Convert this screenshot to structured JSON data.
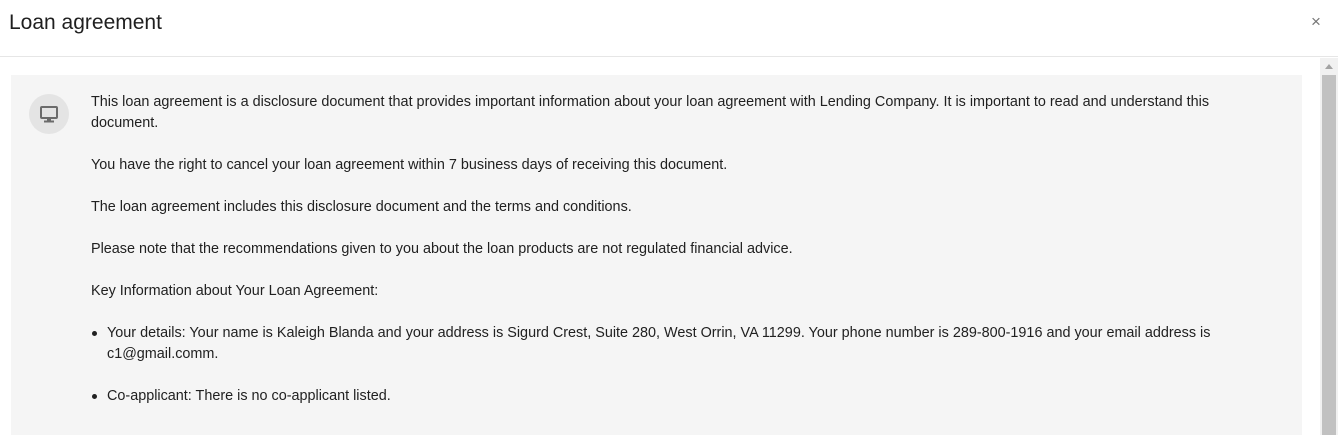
{
  "dialog": {
    "title": "Loan agreement",
    "close_label": "×"
  },
  "content": {
    "icon": "desktop-monitor-icon",
    "paragraphs": [
      "This loan agreement is a disclosure document that provides important information about your loan agreement with Lending Company. It is important to read and understand this document.",
      "You have the right to cancel your loan agreement within 7 business days of receiving this document.",
      "The loan agreement includes this disclosure document and the terms and conditions.",
      "Please note that the recommendations given to you about the loan products are not regulated financial advice.",
      "Key Information about Your Loan Agreement:"
    ],
    "bullets": [
      "Your details: Your name is Kaleigh Blanda and your address is Sigurd Crest, Suite 280, West Orrin, VA 11299. Your phone number is 289-800-1916 and your email address is c1@gmail.comm.",
      "Co-applicant: There is no co-applicant listed."
    ]
  },
  "colors": {
    "panel_background": "#f5f5f5",
    "avatar_background": "#e4e4e4",
    "icon": "#6b6b6b",
    "scrollbar_thumb": "#c1c1c1"
  }
}
